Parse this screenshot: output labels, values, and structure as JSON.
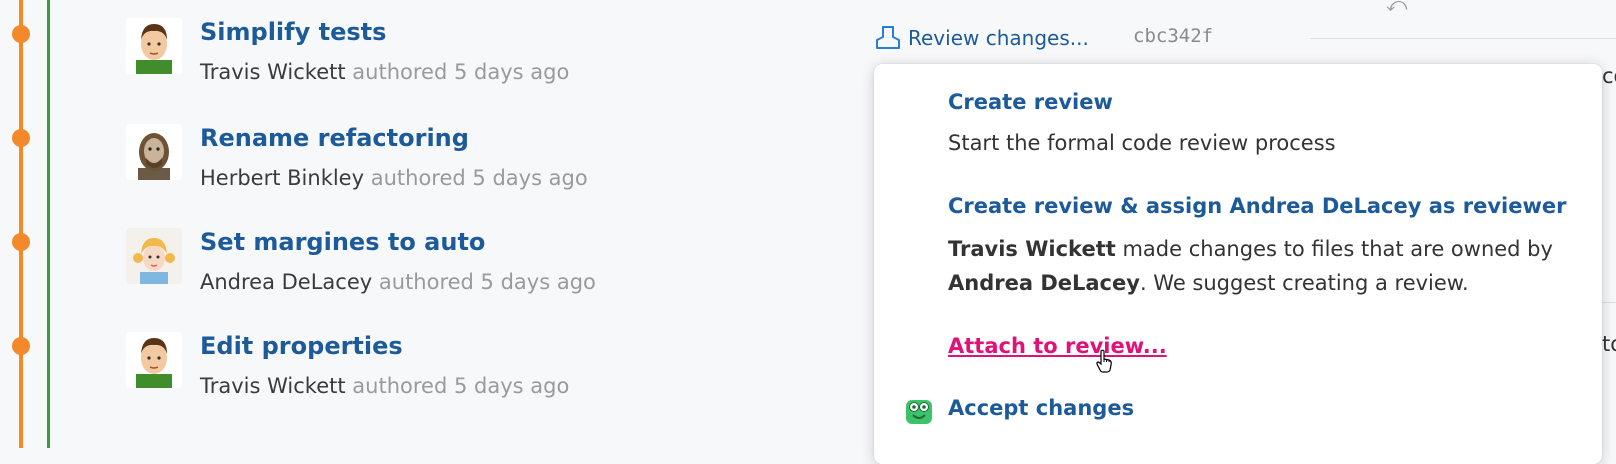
{
  "commits": [
    {
      "title": "Simplify tests",
      "author": "Travis Wickett",
      "meta": "authored 5 days ago",
      "avatar": "avatar-travis"
    },
    {
      "title": "Rename refactoring",
      "author": "Herbert Binkley",
      "meta": "authored 5 days ago",
      "avatar": "avatar-herbert"
    },
    {
      "title": "Set margines to auto",
      "author": "Andrea DeLacey",
      "meta": "authored 5 days ago",
      "avatar": "avatar-andrea"
    },
    {
      "title": "Edit properties",
      "author": "Travis Wickett",
      "meta": "authored 5 days ago",
      "avatar": "avatar-travis"
    }
  ],
  "review_link": {
    "label": "Review changes...",
    "icon": "review-icon"
  },
  "hash": "cbc342f",
  "edge_text": {
    "top": "co",
    "bottom": "to"
  },
  "menu": {
    "create_review": {
      "title": "Create review",
      "desc": "Start the formal code review process"
    },
    "create_assign": {
      "title": "Create review & assign Andrea DeLacey as reviewer",
      "desc_author": "Travis Wickett",
      "desc_mid": " made changes to files that are owned by",
      "desc_owner": "Andrea DeLacey",
      "desc_end": ". We suggest creating a review."
    },
    "attach": {
      "label": "Attach to review..."
    },
    "accept": {
      "label": "Accept changes",
      "icon": "accept-face-icon"
    }
  },
  "colors": {
    "link": "#1d5a99",
    "hover_link": "#e0127a",
    "graph_orange": "#f4892b",
    "graph_green": "#3c9a3c"
  }
}
